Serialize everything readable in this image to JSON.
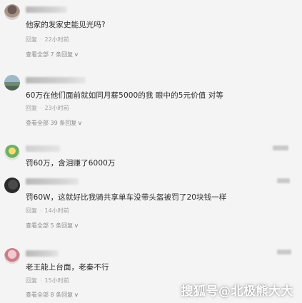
{
  "comments": [
    {
      "text": "他家的发家史能见光吗?",
      "reply_label": "回复",
      "time": "22小时前",
      "view_replies": "查看全部 7 条回复",
      "avatar": "person-photo-avatar"
    },
    {
      "text": "60万在他们面前就如同月薪5000的我 眼中的5元价值 对等",
      "reply_label": "回复",
      "time": "23小时前",
      "view_replies": "查看全部 39 条回复",
      "avatar": "landscape-avatar"
    },
    {
      "text": "罚60万，含泪赚了6000万",
      "avatar": "cartoon-avatar"
    },
    {
      "text": "罚60W，这就好比我骑共享单车没带头盔被罚了20块钱一样",
      "reply_label": "回复",
      "time": "14小时前",
      "view_replies": "查看全部 5 条回复",
      "avatar": "dark-photo-avatar"
    },
    {
      "text": "老王能上台面，老秦不行",
      "reply_label": "回复",
      "time": "15小时前",
      "view_replies": "查看全部 8 条回复",
      "avatar": "pink-avatar"
    }
  ],
  "watermark": "搜狐号@北极熊大大",
  "colors": {
    "background": "#f4f4f4",
    "text": "#2b2b2b",
    "meta": "#9c9c9c",
    "watermark": "#ffffff"
  }
}
